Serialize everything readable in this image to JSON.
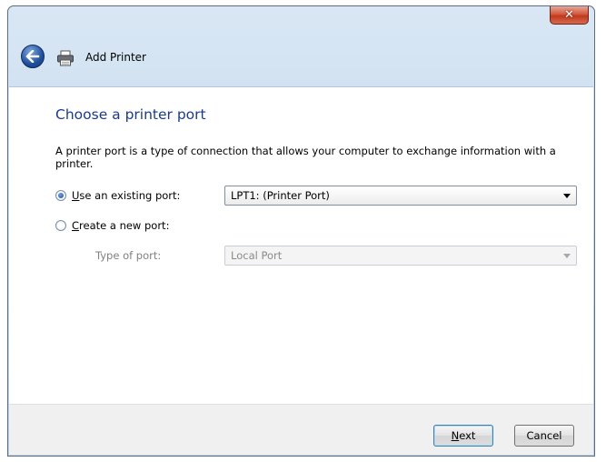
{
  "window": {
    "close_glyph": "✕"
  },
  "nav": {
    "title": "Add Printer",
    "back_icon": "back-arrow-icon",
    "app_icon": "printer-icon"
  },
  "page": {
    "heading": "Choose a printer port",
    "description": "A printer port is a type of connection that allows your computer to exchange information with a printer."
  },
  "options": {
    "existing": {
      "label_hot": "U",
      "label_rest": "se an existing port:",
      "selected": true,
      "value": "LPT1: (Printer Port)"
    },
    "new": {
      "label_hot": "C",
      "label_rest": "reate a new port:",
      "selected": false,
      "type_label": "Type of port:",
      "type_value": "Local Port"
    }
  },
  "footer": {
    "next_hot": "N",
    "next_rest": "ext",
    "cancel": "Cancel"
  },
  "colors": {
    "heading": "#1a3b8c",
    "close": "#c0391e",
    "accent": "#1f4f9d"
  }
}
